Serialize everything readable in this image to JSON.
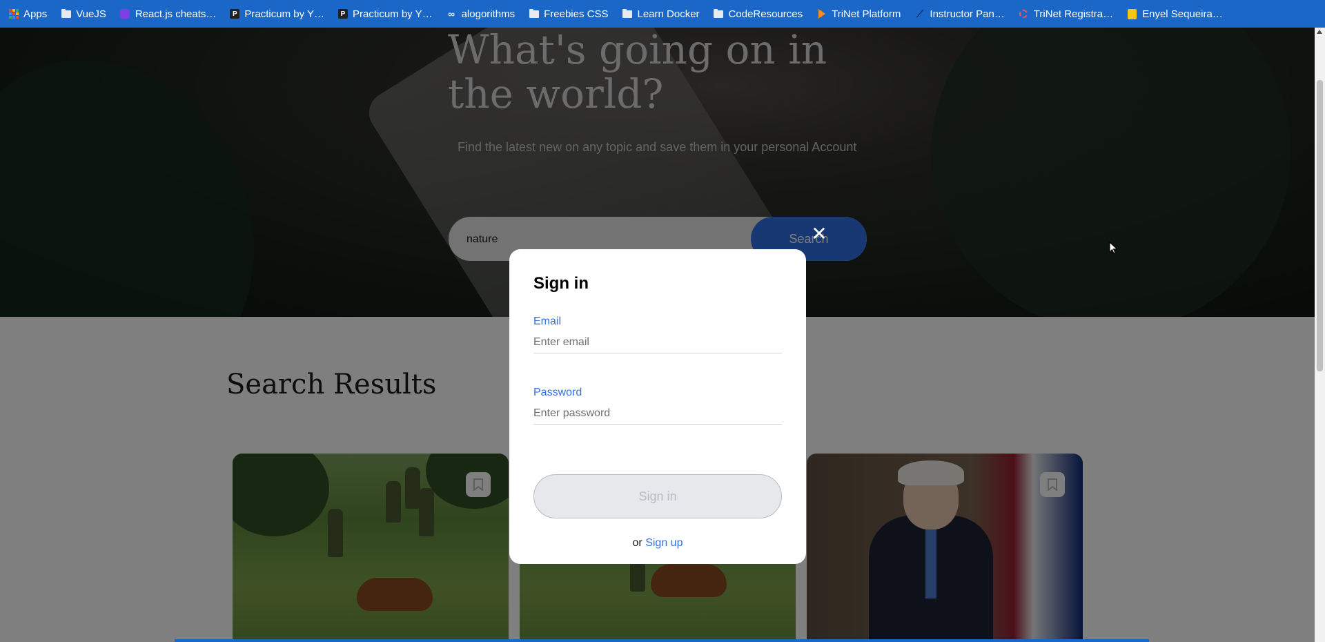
{
  "bookmarks": [
    {
      "label": "Apps",
      "icon": "apps-grid-icon"
    },
    {
      "label": "VueJS",
      "icon": "folder-icon"
    },
    {
      "label": "React.js cheats…",
      "icon": "react-cheatsheet-icon"
    },
    {
      "label": "Practicum by Y…",
      "icon": "practicum-icon"
    },
    {
      "label": "Practicum by Y…",
      "icon": "practicum-icon"
    },
    {
      "label": "alogorithms",
      "icon": "link-icon"
    },
    {
      "label": "Freebies CSS",
      "icon": "folder-icon"
    },
    {
      "label": "Learn Docker",
      "icon": "folder-icon"
    },
    {
      "label": "CodeResources",
      "icon": "folder-icon"
    },
    {
      "label": "TriNet Platform",
      "icon": "trinet-icon"
    },
    {
      "label": "Instructor Pan…",
      "icon": "chart-icon"
    },
    {
      "label": "TriNet Registra…",
      "icon": "ring-icon"
    },
    {
      "label": "Enyel Sequeira…",
      "icon": "notebook-icon"
    }
  ],
  "hero": {
    "title": "What's going on in the world?",
    "subtitle": "Find the latest new on any topic and save them in your personal Account",
    "search_value": "nature",
    "search_button": "Search"
  },
  "results": {
    "title": "Search Results"
  },
  "modal": {
    "title": "Sign in",
    "email_label": "Email",
    "email_placeholder": "Enter email",
    "password_label": "Password",
    "password_placeholder": "Enter password",
    "submit_label": "Sign in",
    "alt_prefix": "or",
    "alt_link": "Sign up",
    "close_symbol": "✕"
  },
  "colors": {
    "accent": "#2f71e5",
    "bookmarks_bar": "#1a67c8"
  }
}
